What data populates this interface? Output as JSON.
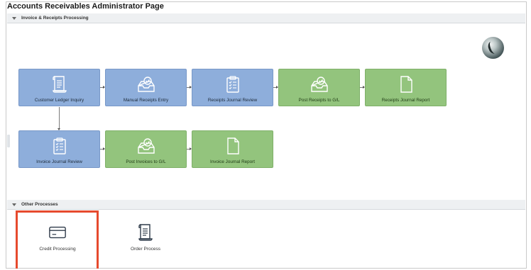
{
  "page": {
    "title": "Accounts Receivables Administrator Page"
  },
  "sections": {
    "invoice": {
      "label": "Invoice & Receipts Processing"
    },
    "other": {
      "label": "Other Processes"
    }
  },
  "tiles": {
    "customer_ledger": {
      "label": "Customer Ledger Inquiry",
      "color": "blue",
      "icon": "ledger-icon"
    },
    "manual_receipts": {
      "label": "Manual Receipts Entry",
      "color": "blue",
      "icon": "inbox-check-icon"
    },
    "receipts_journal_review": {
      "label": "Receipts Journal Review",
      "color": "blue",
      "icon": "clipboard-list-icon"
    },
    "post_receipts": {
      "label": "Post Receipts to G/L",
      "color": "green",
      "icon": "inbox-check-icon"
    },
    "receipts_journal_report": {
      "label": "Receipts Journal Report",
      "color": "green",
      "icon": "document-icon"
    },
    "invoice_journal_review": {
      "label": "Invoice Journal Review",
      "color": "blue",
      "icon": "clipboard-list-icon"
    },
    "post_invoices": {
      "label": "Post Invoices to G/L",
      "color": "green",
      "icon": "inbox-check-icon"
    },
    "invoice_journal_report": {
      "label": "Invoice Journal Report",
      "color": "green",
      "icon": "document-icon"
    }
  },
  "other_processes": {
    "credit_processing": {
      "label": "Credit Processing",
      "icon": "credit-card-icon",
      "highlighted": true
    },
    "order_process": {
      "label": "Order Process",
      "icon": "ledger-icon"
    }
  },
  "colors": {
    "tile_blue": "#8eaedb",
    "tile_green": "#93c47d",
    "highlight": "#e64a2e",
    "section_header_bg": "#eef0f2"
  }
}
